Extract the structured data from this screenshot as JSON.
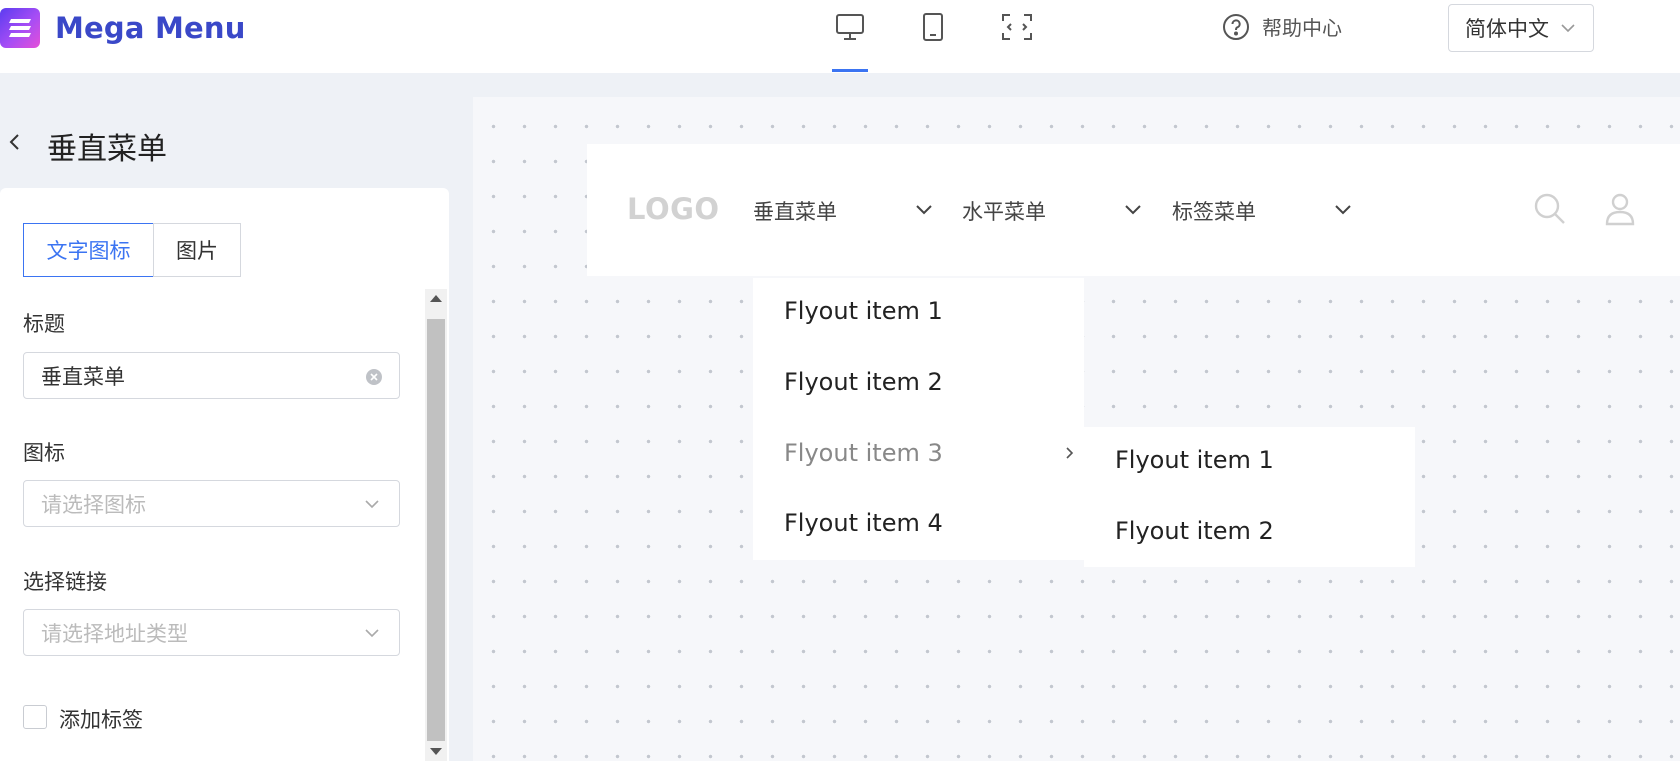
{
  "app": {
    "brand": "Mega Menu"
  },
  "devices": {
    "items": [
      "desktop-icon",
      "tablet-icon",
      "fullscreen-icon"
    ],
    "active": "desktop-icon"
  },
  "header": {
    "help_label": "帮助中心",
    "language": "简体中文"
  },
  "panel": {
    "title": "垂直菜单",
    "tabs": [
      {
        "label": "文字图标",
        "active": true
      },
      {
        "label": "图片",
        "active": false
      }
    ],
    "title_field": {
      "label": "标题",
      "value": "垂直菜单"
    },
    "icon_field": {
      "label": "图标",
      "placeholder": "请选择图标"
    },
    "link_field": {
      "label": "选择链接",
      "placeholder": "请选择地址类型"
    },
    "tag_checkbox": {
      "label": "添加标签",
      "checked": false
    }
  },
  "preview": {
    "logo": "LOGO",
    "nav_items": [
      {
        "label": "垂直菜单"
      },
      {
        "label": "水平菜单"
      },
      {
        "label": "标签菜单"
      }
    ],
    "nav_icons": [
      "search-icon",
      "user-icon"
    ],
    "flyout": [
      {
        "label": "Flyout item 1"
      },
      {
        "label": "Flyout item 2"
      },
      {
        "label": "Flyout item 3",
        "has_submenu": true
      },
      {
        "label": "Flyout item 4"
      }
    ],
    "submenu": [
      {
        "label": "Flyout item 1"
      },
      {
        "label": "Flyout item 2"
      }
    ]
  },
  "colors": {
    "accent": "#3b74f2",
    "brand": "#3a48c8"
  }
}
